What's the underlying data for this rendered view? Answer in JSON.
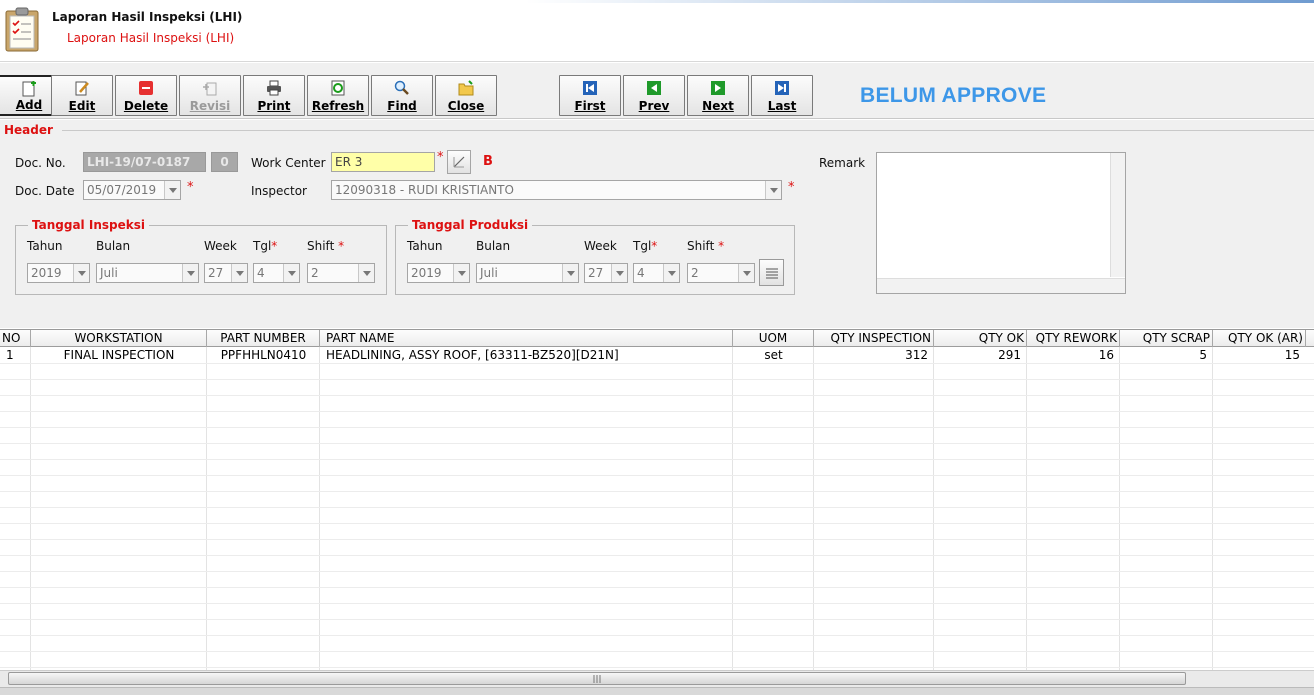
{
  "window": {
    "title": "Laporan Hasil Inspeksi (LHI)",
    "subtitle": "Laporan Hasil Inspeksi (LHI)"
  },
  "toolbar": {
    "buttons": [
      {
        "label": "Add",
        "icon": "add-icon"
      },
      {
        "label": "Edit",
        "icon": "edit-icon"
      },
      {
        "label": "Delete",
        "icon": "delete-icon"
      },
      {
        "label": "Revisi",
        "icon": "revisi-icon",
        "disabled": true
      },
      {
        "label": "Print",
        "icon": "print-icon"
      },
      {
        "label": "Refresh",
        "icon": "refresh-icon"
      },
      {
        "label": "Find",
        "icon": "find-icon"
      },
      {
        "label": "Close",
        "icon": "close-folder-icon"
      }
    ],
    "nav_buttons": [
      {
        "label": "First",
        "icon": "first-icon"
      },
      {
        "label": "Prev",
        "icon": "prev-icon"
      },
      {
        "label": "Next",
        "icon": "next-icon"
      },
      {
        "label": "Last",
        "icon": "last-icon"
      }
    ],
    "status": "BELUM APPROVE"
  },
  "header": {
    "legend": "Header",
    "doc_no_label": "Doc. No.",
    "doc_no": "LHI-19/07-0187",
    "revision": "0",
    "doc_date_label": "Doc. Date",
    "doc_date": "05/07/2019",
    "work_center_label": "Work Center",
    "work_center": "ER 3",
    "work_center_flag": "B",
    "inspector_label": "Inspector",
    "inspector": "12090318 - RUDI KRISTIANTO",
    "remark_label": "Remark",
    "required_mark": "*"
  },
  "tanggal_inspeksi": {
    "title": "Tanggal Inspeksi",
    "labels": {
      "tahun": "Tahun",
      "bulan": "Bulan",
      "week": "Week",
      "tgl": "Tgl",
      "shift": "Shift"
    },
    "values": {
      "tahun": "2019",
      "bulan": "Juli",
      "week": "27",
      "tgl": "4",
      "shift": "2"
    }
  },
  "tanggal_produksi": {
    "title": "Tanggal Produksi",
    "labels": {
      "tahun": "Tahun",
      "bulan": "Bulan",
      "week": "Week",
      "tgl": "Tgl",
      "shift": "Shift"
    },
    "values": {
      "tahun": "2019",
      "bulan": "Juli",
      "week": "27",
      "tgl": "4",
      "shift": "2"
    }
  },
  "grid": {
    "columns": [
      "NO",
      "WORKSTATION",
      "PART NUMBER",
      "PART NAME",
      "UOM",
      "QTY INSPECTION",
      "QTY OK",
      "QTY REWORK",
      "QTY SCRAP",
      "QTY OK (AR)"
    ],
    "rows": [
      [
        "1",
        "FINAL INSPECTION",
        "PPFHHLN0410",
        "HEADLINING, ASSY ROOF, [63311-BZ520][D21N]",
        "set",
        "312",
        "291",
        "16",
        "5",
        "15"
      ]
    ]
  },
  "colors": {
    "status": "#3d97e8",
    "required": "#dd1111",
    "work_center_bg": "#ffffa8"
  }
}
